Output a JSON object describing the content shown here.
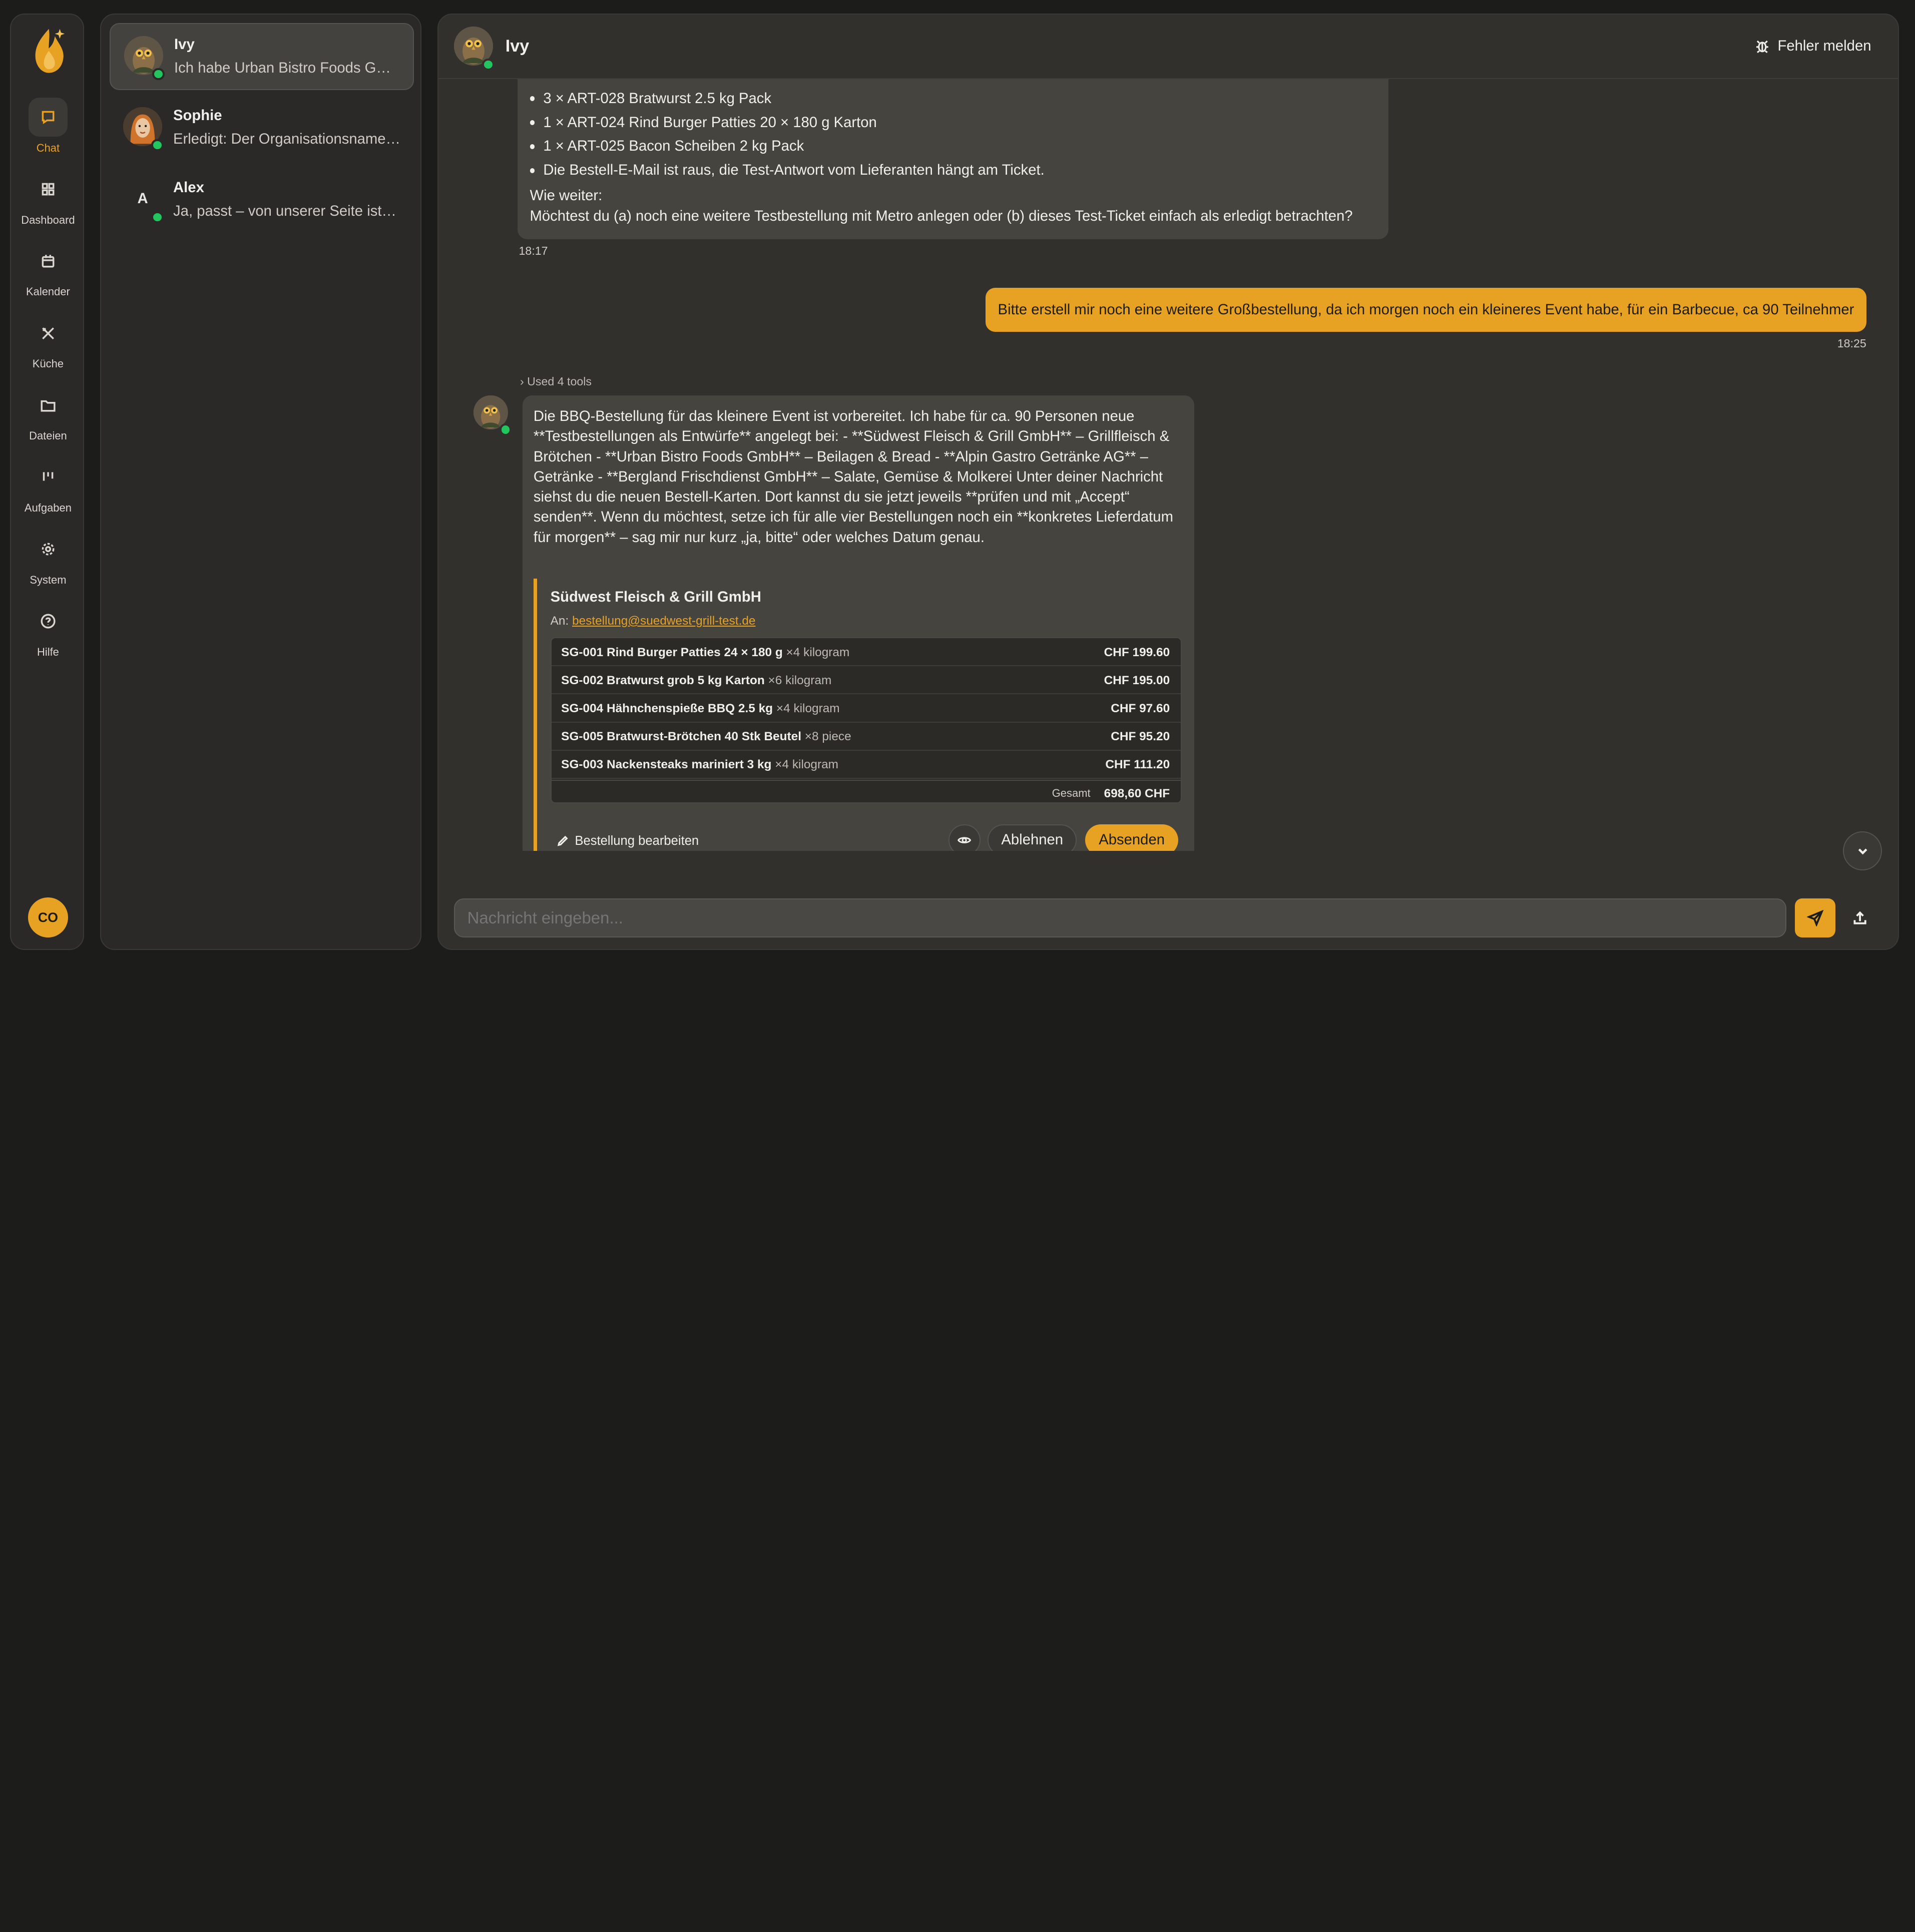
{
  "nav": {
    "items": [
      {
        "label": "Chat",
        "icon": "chat-icon"
      },
      {
        "label": "Dashboard",
        "icon": "dashboard-icon"
      },
      {
        "label": "Kalender",
        "icon": "calendar-icon"
      },
      {
        "label": "Küche",
        "icon": "kitchen-icon"
      },
      {
        "label": "Dateien",
        "icon": "folder-icon"
      },
      {
        "label": "Aufgaben",
        "icon": "tasks-icon"
      },
      {
        "label": "System",
        "icon": "gear-icon"
      },
      {
        "label": "Hilfe",
        "icon": "help-icon"
      }
    ],
    "user_initials": "CO"
  },
  "conversations": [
    {
      "name": "Ivy",
      "preview": "Ich habe Urban Bistro Foods GmbH …"
    },
    {
      "name": "Sophie",
      "preview": "Erledigt: Der Organisationsname i…"
    },
    {
      "name": "Alex",
      "preview": "Ja, passt – von unserer Seite ist a…",
      "initial": "A"
    }
  ],
  "header": {
    "title": "Ivy",
    "report_label": "Fehler melden"
  },
  "messages": {
    "first": {
      "items": [
        "3 × ART-028 Bratwurst 2.5 kg Pack",
        "1 × ART-024 Rind Burger Patties 20 × 180 g Karton",
        "1 × ART-025 Bacon Scheiben 2 kg Pack",
        "Die Bestell-E-Mail ist raus, die Test-Antwort vom Lieferanten hängt am Ticket."
      ],
      "question_title": "Wie weiter:",
      "question": "Möchtest du (a) noch eine weitere Testbestellung mit Metro anlegen oder (b) dieses Test-Ticket einfach als erledigt betrachten?",
      "time": "18:17"
    },
    "user": {
      "text": "Bitte erstell mir noch eine weitere Großbestellung, da ich morgen noch ein kleineres Event habe, für ein Barbecue, ca 90 Teilnehmer",
      "time": "18:25"
    },
    "tools_label": "Used 4 tools",
    "reply": {
      "text": "Die BBQ-Bestellung für das kleinere Event ist vorbereitet. Ich habe für ca. 90 Personen neue **Testbestellungen als Entwürfe** angelegt bei: - **Südwest Fleisch & Grill GmbH** – Grillfleisch & Brötchen - **Urban Bistro Foods GmbH** – Beilagen & Bread - **Alpin Gastro Getränke AG** – Getränke - **Bergland Frischdienst GmbH** – Salate, Gemüse & Molkerei Unter deiner Nachricht siehst du die neuen Bestell-Karten. Dort kannst du sie jetzt jeweils **prüfen und mit „Accept“ senden**. Wenn du möchtest, setze ich für alle vier Bestellungen noch ein **konkretes Lieferdatum für morgen** – sag mir nur kurz „ja, bitte“ oder welches Datum genau."
    }
  },
  "order": {
    "supplier": "Südwest Fleisch & Grill GmbH",
    "to_label": "An:",
    "email": "bestellung@suedwest-grill-test.de",
    "items": [
      {
        "name": "SG-001 Rind Burger Patties 24 × 180 g",
        "qty": "×4 kilogram",
        "price": "CHF 199.60"
      },
      {
        "name": "SG-002 Bratwurst grob 5 kg Karton",
        "qty": "×6 kilogram",
        "price": "CHF 195.00"
      },
      {
        "name": "SG-004 Hähnchenspieße BBQ 2.5 kg",
        "qty": "×4 kilogram",
        "price": "CHF 97.60"
      },
      {
        "name": "SG-005 Bratwurst-Brötchen 40 Stk Beutel",
        "qty": "×8 piece",
        "price": "CHF 95.20"
      },
      {
        "name": "SG-003 Nackensteaks mariniert 3 kg",
        "qty": "×4 kilogram",
        "price": "CHF 111.20"
      }
    ],
    "total_label": "Gesamt",
    "total": "698,60 CHF",
    "edit_label": "Bestellung bearbeiten",
    "reject_label": "Ablehnen",
    "send_label": "Absenden"
  },
  "composer": {
    "placeholder": "Nachricht eingeben..."
  },
  "colors": {
    "accent": "#e8a223",
    "online": "#22c55e"
  }
}
